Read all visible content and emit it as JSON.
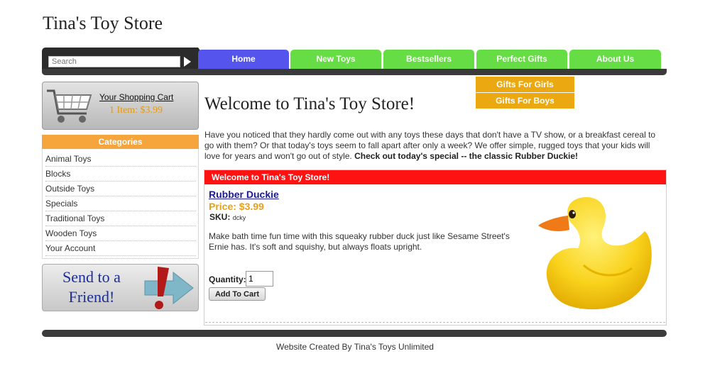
{
  "site": {
    "title": "Tina's Toy Store"
  },
  "search": {
    "placeholder": "Search"
  },
  "nav": {
    "tabs": [
      {
        "label": "Home"
      },
      {
        "label": "New Toys"
      },
      {
        "label": "Bestsellers"
      },
      {
        "label": "Perfect Gifts"
      },
      {
        "label": "About Us"
      }
    ],
    "dropdown": [
      "Gifts For Girls",
      "Gifts For Boys"
    ]
  },
  "cart": {
    "title": "Your Shopping Cart",
    "summary": "1 Item: $3.99"
  },
  "categories": {
    "heading": "Categories",
    "items": [
      "Animal Toys",
      "Blocks",
      "Outside Toys",
      "Specials",
      "Traditional Toys",
      "Wooden Toys",
      "Your Account"
    ]
  },
  "friend": {
    "line1": "Send to a",
    "line2": "Friend!"
  },
  "main": {
    "welcome": "Welcome to Tina's Toy Store!",
    "intro": "Have you noticed that they hardly come out with any toys these days that don't have a TV show, or a breakfast cereal to go with them? Or that today's toys seem to fall apart after only a week? We offer simple, rugged toys that your kids will love for years and won't go out of style.",
    "intro_bold": "Check out today's special -- the classic Rubber Duckie!"
  },
  "product": {
    "header": "Welcome to Tina's Toy Store!",
    "name": "Rubber Duckie",
    "price": "Price: $3.99",
    "sku_label": "SKU:",
    "sku_value": "dcky",
    "description": "Make bath time fun time with this squeaky rubber duck just like Sesame Street's Ernie has. It's soft and squishy, but always floats upright.",
    "quantity_label": "Quantity:",
    "quantity_value": "1",
    "add_button": "Add To Cart"
  },
  "footer": {
    "text": "Website Created By Tina's Toys Unlimited"
  },
  "colors": {
    "home_tab": "#5555ee",
    "tab_green": "#66dd44",
    "dropdown": "#eba811",
    "categories_head": "#f6a43c",
    "product_header": "#ff1212",
    "price": "#e8a017"
  }
}
